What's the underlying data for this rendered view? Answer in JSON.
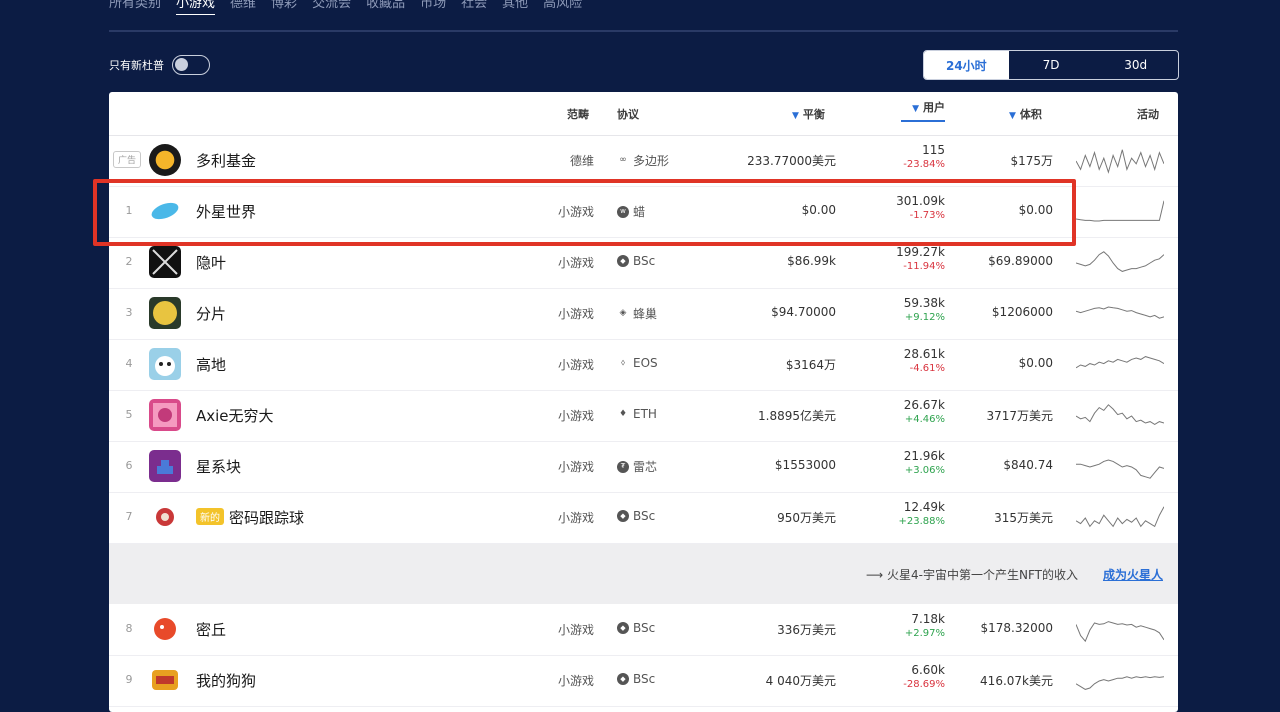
{
  "nav": {
    "items": [
      "所有类别",
      "小游戏",
      "德维",
      "博彩",
      "交流会",
      "收藏品",
      "市场",
      "社会",
      "其他",
      "高风险"
    ],
    "active_index": 1
  },
  "filter": {
    "only_new_label": "只有新杜普",
    "toggle_on": false
  },
  "time_range": {
    "options": [
      "24小时",
      "7D",
      "30d"
    ],
    "active": "24小时"
  },
  "table": {
    "headers": {
      "category": "范畴",
      "protocol": "协议",
      "balance": "平衡",
      "users": "用户",
      "volume": "体积",
      "activity": "活动"
    },
    "ad_row": {
      "badge": "广告",
      "name": "多利基金",
      "category": "德维",
      "protocol": "多边形",
      "protocol_icon": "link-icon",
      "balance": "233.77000美元",
      "users": "115",
      "users_change": "-23.84%",
      "volume": "$175万",
      "spark": [
        0.5,
        0.2,
        0.7,
        0.3,
        0.8,
        0.2,
        0.6,
        0.1,
        0.7,
        0.3,
        0.9,
        0.2,
        0.6,
        0.4,
        0.8,
        0.3,
        0.7,
        0.2,
        0.8,
        0.4
      ]
    },
    "rows": [
      {
        "rank": "1",
        "name": "外星世界",
        "category": "小游戏",
        "protocol": "蜡",
        "protocol_icon": "wax-icon",
        "balance": "$0.00",
        "users": "301.09k",
        "users_change": "-1.73%",
        "change_dir": "neg",
        "volume": "$0.00",
        "badge": "",
        "spark": [
          0.25,
          0.22,
          0.2,
          0.2,
          0.18,
          0.18,
          0.2,
          0.2,
          0.2,
          0.2,
          0.2,
          0.2,
          0.2,
          0.2,
          0.2,
          0.2,
          0.2,
          0.2,
          0.2,
          0.9
        ]
      },
      {
        "rank": "2",
        "name": "隐叶",
        "category": "小游戏",
        "protocol": "BSc",
        "protocol_icon": "bsc-icon",
        "balance": "$86.99k",
        "users": "199.27k",
        "users_change": "-11.94%",
        "change_dir": "neg",
        "volume": "$69.89000",
        "badge": "",
        "spark": [
          0.5,
          0.45,
          0.4,
          0.45,
          0.6,
          0.8,
          0.9,
          0.75,
          0.5,
          0.3,
          0.2,
          0.25,
          0.3,
          0.3,
          0.35,
          0.4,
          0.5,
          0.6,
          0.65,
          0.8
        ]
      },
      {
        "rank": "3",
        "name": "分片",
        "category": "小游戏",
        "protocol": "蜂巢",
        "protocol_icon": "hive-icon",
        "balance": "$94.70000",
        "users": "59.38k",
        "users_change": "+9.12%",
        "change_dir": "pos",
        "volume": "$1206000",
        "badge": "",
        "spark": [
          0.6,
          0.55,
          0.6,
          0.65,
          0.7,
          0.72,
          0.68,
          0.75,
          0.72,
          0.7,
          0.65,
          0.6,
          0.62,
          0.55,
          0.5,
          0.45,
          0.4,
          0.45,
          0.35,
          0.4
        ]
      },
      {
        "rank": "4",
        "name": "高地",
        "category": "小游戏",
        "protocol": "EOS",
        "protocol_icon": "eos-icon",
        "balance": "$3164万",
        "users": "28.61k",
        "users_change": "-4.61%",
        "change_dir": "neg",
        "volume": "$0.00",
        "badge": "",
        "spark": [
          0.4,
          0.5,
          0.45,
          0.55,
          0.5,
          0.6,
          0.55,
          0.65,
          0.6,
          0.7,
          0.65,
          0.6,
          0.7,
          0.75,
          0.7,
          0.8,
          0.75,
          0.7,
          0.65,
          0.55
        ]
      },
      {
        "rank": "5",
        "name": "Axie无穷大",
        "category": "小游戏",
        "protocol": "ETH",
        "protocol_icon": "eth-icon",
        "balance": "1.8895亿美元",
        "users": "26.67k",
        "users_change": "+4.46%",
        "change_dir": "pos",
        "volume": "3717万美元",
        "badge": "",
        "spark": [
          0.5,
          0.4,
          0.45,
          0.3,
          0.6,
          0.8,
          0.7,
          0.9,
          0.75,
          0.55,
          0.6,
          0.4,
          0.5,
          0.3,
          0.35,
          0.25,
          0.3,
          0.2,
          0.3,
          0.25
        ]
      },
      {
        "rank": "6",
        "name": "星系块",
        "category": "小游戏",
        "protocol": "雷芯",
        "protocol_icon": "thunder-core-icon",
        "balance": "$1553000",
        "users": "21.96k",
        "users_change": "+3.06%",
        "change_dir": "pos",
        "volume": "$840.74",
        "badge": "",
        "spark": [
          0.6,
          0.6,
          0.55,
          0.5,
          0.55,
          0.6,
          0.7,
          0.75,
          0.7,
          0.6,
          0.5,
          0.55,
          0.5,
          0.4,
          0.2,
          0.15,
          0.1,
          0.3,
          0.5,
          0.45
        ]
      },
      {
        "rank": "7",
        "name": "密码跟踪球",
        "category": "小游戏",
        "protocol": "BSc",
        "protocol_icon": "bsc-icon",
        "balance": "950万美元",
        "users": "12.49k",
        "users_change": "+23.88%",
        "change_dir": "pos",
        "volume": "315万美元",
        "badge": "新的",
        "spark": [
          0.4,
          0.3,
          0.5,
          0.2,
          0.4,
          0.3,
          0.6,
          0.4,
          0.2,
          0.5,
          0.3,
          0.45,
          0.35,
          0.5,
          0.2,
          0.4,
          0.3,
          0.2,
          0.6,
          0.9
        ]
      },
      {
        "rank": "8",
        "name": "密丘",
        "category": "小游戏",
        "protocol": "BSc",
        "protocol_icon": "bsc-icon",
        "balance": "336万美元",
        "users": "7.18k",
        "users_change": "+2.97%",
        "change_dir": "pos",
        "volume": "$178.32000",
        "badge": "",
        "spark": [
          0.7,
          0.3,
          0.1,
          0.5,
          0.75,
          0.7,
          0.72,
          0.8,
          0.75,
          0.7,
          0.72,
          0.68,
          0.7,
          0.6,
          0.65,
          0.6,
          0.55,
          0.5,
          0.4,
          0.15
        ]
      },
      {
        "rank": "9",
        "name": "我的狗狗",
        "category": "小游戏",
        "protocol": "BSc",
        "protocol_icon": "bsc-icon",
        "balance": "4 040万美元",
        "users": "6.60k",
        "users_change": "-28.69%",
        "change_dir": "neg",
        "volume": "416.07k美元",
        "badge": "",
        "spark": [
          0.4,
          0.3,
          0.2,
          0.25,
          0.4,
          0.5,
          0.55,
          0.5,
          0.55,
          0.6,
          0.6,
          0.65,
          0.6,
          0.65,
          0.62,
          0.65,
          0.62,
          0.65,
          0.63,
          0.65
        ]
      }
    ]
  },
  "promo": {
    "text": "火星4-宇宙中第一个产生NFT的收入",
    "link": "成为火星人"
  },
  "colors": {
    "background": "#0c1c44",
    "accent": "#2b6fd6",
    "highlight_border": "#e03426",
    "negative": "#d9343f",
    "positive": "#2ea34e",
    "badge_new": "#f3c32a"
  }
}
